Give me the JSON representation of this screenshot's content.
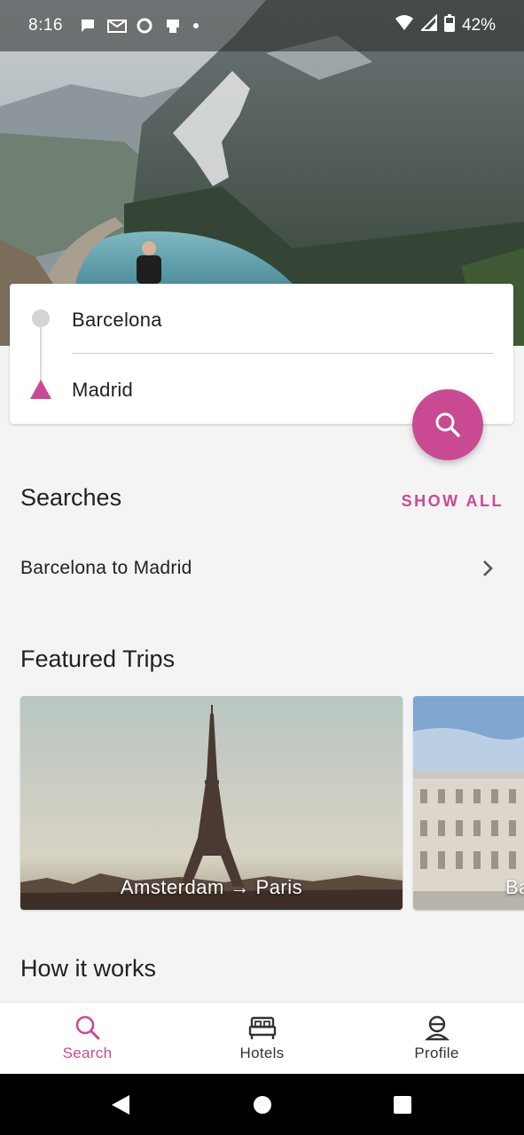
{
  "status_bar": {
    "time": "8:16",
    "battery": "42%",
    "notification_icons": [
      "chat-bubble-icon",
      "mail-icon",
      "sync-icon",
      "print-icon",
      "dot-icon"
    ]
  },
  "search": {
    "origin": "Barcelona",
    "destination": "Madrid"
  },
  "searches_section": {
    "title": "Searches",
    "show_all": "SHOW ALL",
    "items": [
      {
        "label": "Barcelona to Madrid"
      }
    ]
  },
  "featured_section": {
    "title": "Featured Trips",
    "trips": [
      {
        "label": "Amsterdam → Paris"
      },
      {
        "label": "Ba"
      }
    ]
  },
  "how_section": {
    "title": "How it works"
  },
  "bottom_nav": {
    "items": [
      {
        "label": "Search",
        "icon": "search-icon",
        "active": true
      },
      {
        "label": "Hotels",
        "icon": "bed-icon",
        "active": false
      },
      {
        "label": "Profile",
        "icon": "profile-icon",
        "active": false
      }
    ]
  },
  "colors": {
    "accent": "#c94a93",
    "background": "#f4f4f4"
  }
}
